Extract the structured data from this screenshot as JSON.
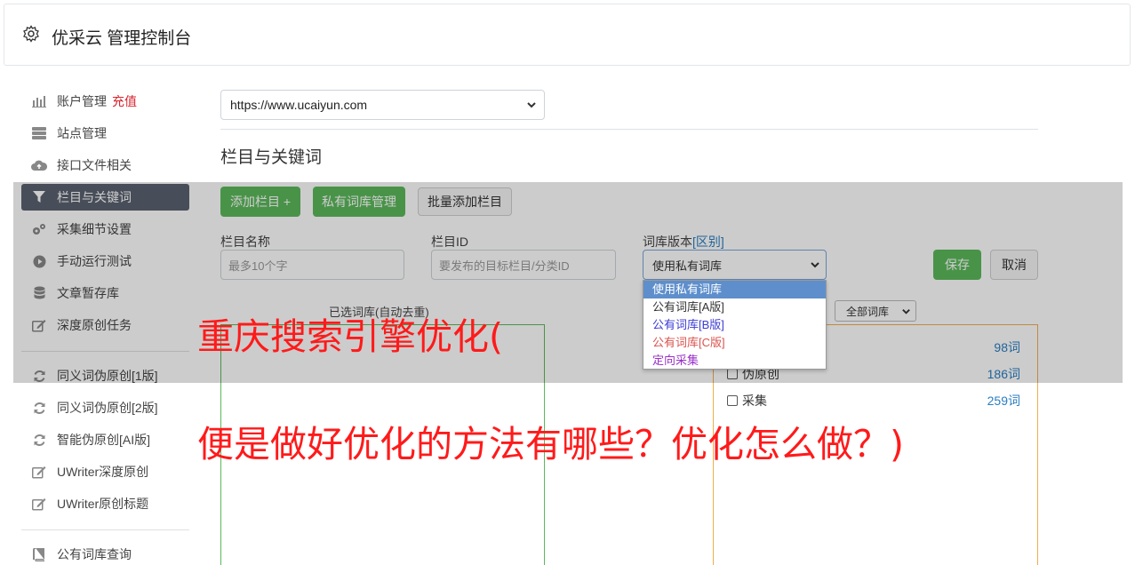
{
  "header": {
    "title": "优采云 管理控制台"
  },
  "sidebar": {
    "items": [
      {
        "label": "账户管理",
        "badge": "充值",
        "icon": "bar-chart-icon"
      },
      {
        "label": "站点管理",
        "icon": "server-icon"
      },
      {
        "label": "接口文件相关",
        "icon": "cloud-upload-icon"
      },
      {
        "label": "栏目与关键词",
        "icon": "filter-icon",
        "active": true
      },
      {
        "label": "采集细节设置",
        "icon": "cogs-icon"
      },
      {
        "label": "手动运行测试",
        "icon": "play-circle-icon"
      },
      {
        "label": "文章暂存库",
        "icon": "database-icon"
      },
      {
        "label": "深度原创任务",
        "icon": "edit-icon"
      },
      {
        "label": "同义词伪原创[1版]",
        "icon": "refresh-icon"
      },
      {
        "label": "同义词伪原创[2版]",
        "icon": "refresh-icon"
      },
      {
        "label": "智能伪原创[AI版]",
        "icon": "refresh-icon"
      },
      {
        "label": "UWriter深度原创",
        "icon": "edit-icon"
      },
      {
        "label": "UWriter原创标题",
        "icon": "edit-icon"
      },
      {
        "label": "公有词库查询",
        "icon": "book-icon"
      }
    ]
  },
  "site_select": {
    "value": "https://www.ucaiyun.com"
  },
  "section_title": "栏目与关键词",
  "toolbar": {
    "add_column": "添加栏目 +",
    "private_lib": "私有词库管理",
    "batch_add": "批量添加栏目"
  },
  "form": {
    "name_label": "栏目名称",
    "name_placeholder": "最多10个字",
    "id_label": "栏目ID",
    "id_placeholder": "要发布的目标栏目/分类ID",
    "ver_label": "词库版本",
    "ver_link": "[区别]",
    "ver_value": "使用私有词库",
    "save": "保存",
    "cancel": "取消"
  },
  "dropdown": {
    "options": [
      {
        "label": "使用私有词库",
        "color": "#ffffff"
      },
      {
        "label": "公有词库[A版]",
        "color": "#333333"
      },
      {
        "label": "公有词库[B版]",
        "color": "#3b3bd6"
      },
      {
        "label": "公有词库[C版]",
        "color": "#d9534f"
      },
      {
        "label": "定向采集",
        "color": "#9b30c9"
      }
    ]
  },
  "selected_lib_label": "已选词库(自动去重)",
  "lib_filter": {
    "value": "全部词库"
  },
  "libraries": [
    {
      "label": "",
      "count": "98词"
    },
    {
      "label": "伪原创",
      "count": "186词"
    },
    {
      "label": "采集",
      "count": "259词"
    }
  ],
  "overlay_text": {
    "line1": "重庆搜索引擎优化(",
    "line2": "便是做好优化的方法有哪些？优化怎么做？)"
  }
}
